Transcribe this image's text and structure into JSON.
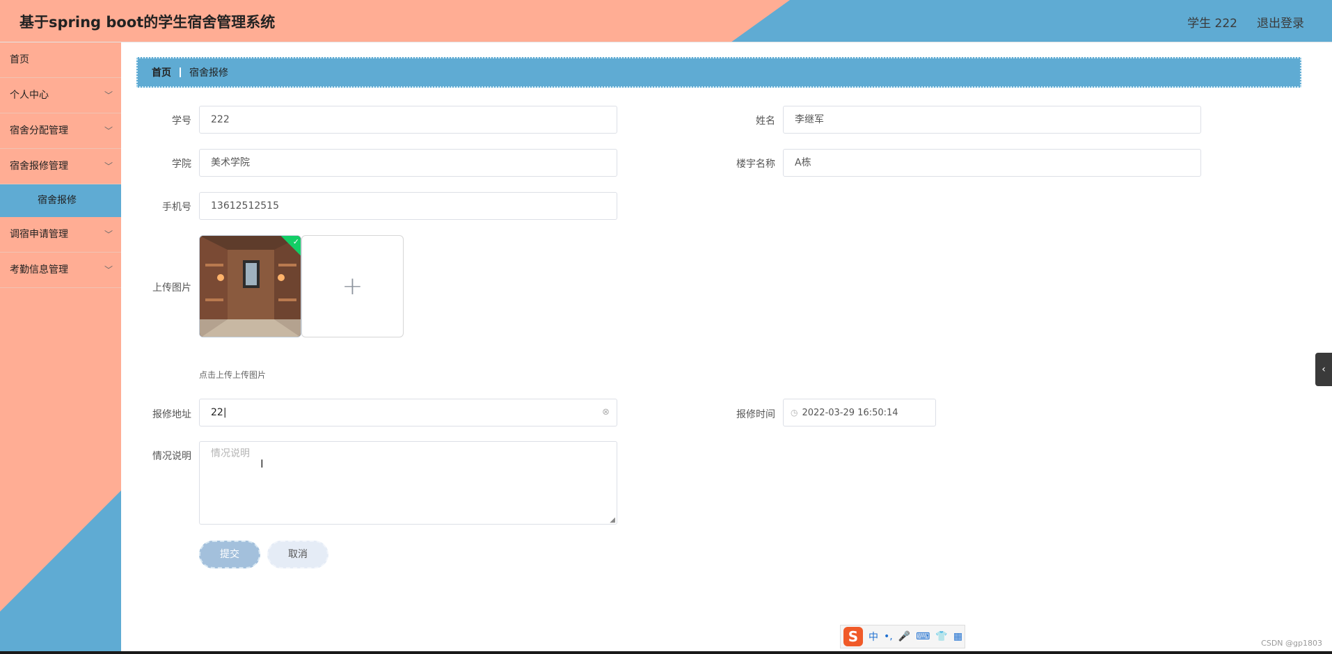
{
  "header": {
    "title": "基于spring boot的学生宿舍管理系统",
    "user": "学生 222",
    "logout": "退出登录",
    "colors": {
      "left": "#ffad94",
      "right": "#5fabd3"
    }
  },
  "sidebar": {
    "items": [
      {
        "label": "首页",
        "chevron": ""
      },
      {
        "label": "个人中心",
        "chevron": "﹀"
      },
      {
        "label": "宿舍分配管理",
        "chevron": "﹀"
      },
      {
        "label": "宿舍报修管理",
        "chevron": "﹀"
      },
      {
        "label": "宿舍报修",
        "chevron": ""
      },
      {
        "label": "调宿申请管理",
        "chevron": "﹀"
      },
      {
        "label": "考勤信息管理",
        "chevron": "﹀"
      }
    ]
  },
  "breadcrumb": {
    "home": "首页",
    "current": "宿舍报修"
  },
  "form": {
    "student_id": {
      "label": "学号",
      "value": "222"
    },
    "name": {
      "label": "姓名",
      "value": "李继军"
    },
    "college": {
      "label": "学院",
      "value": "美术学院"
    },
    "building": {
      "label": "楼宇名称",
      "value": "A栋"
    },
    "phone": {
      "label": "手机号",
      "value": "13612512515"
    },
    "upload": {
      "label": "上传图片",
      "hint": "点击上传上传图片",
      "add_icon": "+"
    },
    "address": {
      "label": "报修地址",
      "value": "22",
      "clear_icon": "⊗"
    },
    "time": {
      "label": "报修时间",
      "value": "2022-03-29 16:50:14",
      "clock_icon": "◷"
    },
    "description": {
      "label": "情况说明",
      "placeholder": "情况说明"
    },
    "submit": "提交",
    "cancel": "取消"
  },
  "side_toggle": "‹",
  "ime": {
    "logo": "S",
    "mode": "中",
    "punct": "•,",
    "mic": "🎤",
    "keyboard": "⌨",
    "skin": "👕",
    "tools": "▦"
  },
  "watermark": "CSDN @gp1803"
}
